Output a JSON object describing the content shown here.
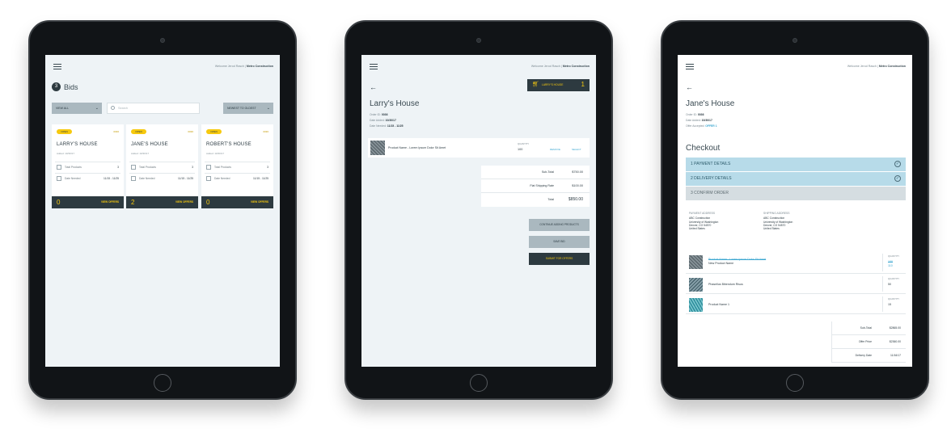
{
  "header": {
    "welcome_prefix": "Welcome Jerod Rasch |",
    "company": "Metro Construction"
  },
  "bids": {
    "count": "3",
    "title": "Bids",
    "filter_label": "VIEW ALL",
    "search_placeholder": "Search",
    "sort_label": "NEWEST TO OLDEST",
    "cards": [
      {
        "status": "OPEN",
        "number": "0036",
        "name": "LARRY'S HOUSE",
        "added": "Added: 10/30/17",
        "total_products_label": "Total Products",
        "total_products": "3",
        "date_needed_label": "Date Needed",
        "date_needed": "11/15 - 11/25",
        "offers_count": "0",
        "view_offers": "VIEW OFFERS"
      },
      {
        "status": "OPEN",
        "number": "0036",
        "name": "JANE'S HOUSE",
        "added": "Added: 10/30/17",
        "total_products_label": "Total Products",
        "total_products": "3",
        "date_needed_label": "Date Needed",
        "date_needed": "11/15 - 11/25",
        "offers_count": "2",
        "view_offers": "VIEW OFFERS"
      },
      {
        "status": "OPEN",
        "number": "0036",
        "name": "ROBERT'S HOUSE",
        "added": "Added: 10/30/17",
        "total_products_label": "Total Products",
        "total_products": "3",
        "date_needed_label": "Date Needed",
        "date_needed": "11/15 - 11/25",
        "offers_count": "0",
        "view_offers": "VIEW OFFERS"
      }
    ]
  },
  "larry": {
    "cart_label": "LARRY'S HOUSE",
    "cart_count": "1",
    "title": "Larry's House",
    "order_id_label": "Order ID:",
    "order_id": "0036",
    "date_added_label": "Date Added:",
    "date_added": "10/30/17",
    "date_needed_label": "Date Needed:",
    "date_needed": "11/15 - 11/25",
    "product_name": "Product Name - Lorem Ipsum Dolor Sit Amet",
    "quantity_label": "QUANTITY",
    "quantity": "100",
    "action_1": "REMOVE",
    "action_2": "SELECT",
    "subtotal_label": "Sub-Total",
    "subtotal": "$750.00",
    "shipping_label": "Flat Shipping Rate",
    "shipping": "$100.00",
    "total_label": "Total",
    "total": "$850.00",
    "continue_label": "CONTINUE ADDING PRODUCTS",
    "save_label": "SAVE BID",
    "submit_label": "SUBMIT FOR OFFERS"
  },
  "jane": {
    "title": "Jane's House",
    "order_id_label": "Order ID:",
    "order_id": "0036",
    "date_added_label": "Date Added:",
    "date_added": "10/30/17",
    "offer_label": "Offer Accepted:",
    "offer": "OFFER 1",
    "checkout_title": "Checkout",
    "steps": [
      {
        "label": "1  PAYMENT DETAILS"
      },
      {
        "label": "2  DELIVERY DETAILS"
      },
      {
        "label": "3  CONFIRM ORDER"
      }
    ],
    "payment_address": {
      "heading": "PAYMENT ADDRESS",
      "lines": [
        "ABC Construction",
        "University of Washington",
        "Denver, CO 54570",
        "United States"
      ]
    },
    "shipping_address": {
      "heading": "SHIPPING ADDRESS",
      "lines": [
        "ABC Construction",
        "University of Washington",
        "Denver, CO 54570",
        "United States"
      ]
    },
    "items": [
      {
        "old_name": "Product Name - Lorem Ipsum Dolor Sit Amet",
        "name": "New Product Name",
        "qty_label": "QUANTITY",
        "old_qty": "100",
        "qty": "110"
      },
      {
        "name": "Phasellus Bibendum Risus",
        "qty_label": "QUANTITY",
        "qty": "50"
      },
      {
        "name": "Product Name 1",
        "qty_label": "QUANTITY",
        "qty": "15"
      }
    ],
    "subtotal_label": "Sub-Total",
    "subtotal": "$2865.00",
    "offer_price_label": "Offer Price",
    "offer_price": "$2360.00",
    "delivery_label": "Delivery Date",
    "delivery": "11/16/17"
  },
  "colors": {
    "accent": "#f6c90e",
    "dark": "#2d3a40",
    "screen_bg": "#eef3f6",
    "step_done": "#b7dbe9",
    "link": "#3aa6d0"
  }
}
